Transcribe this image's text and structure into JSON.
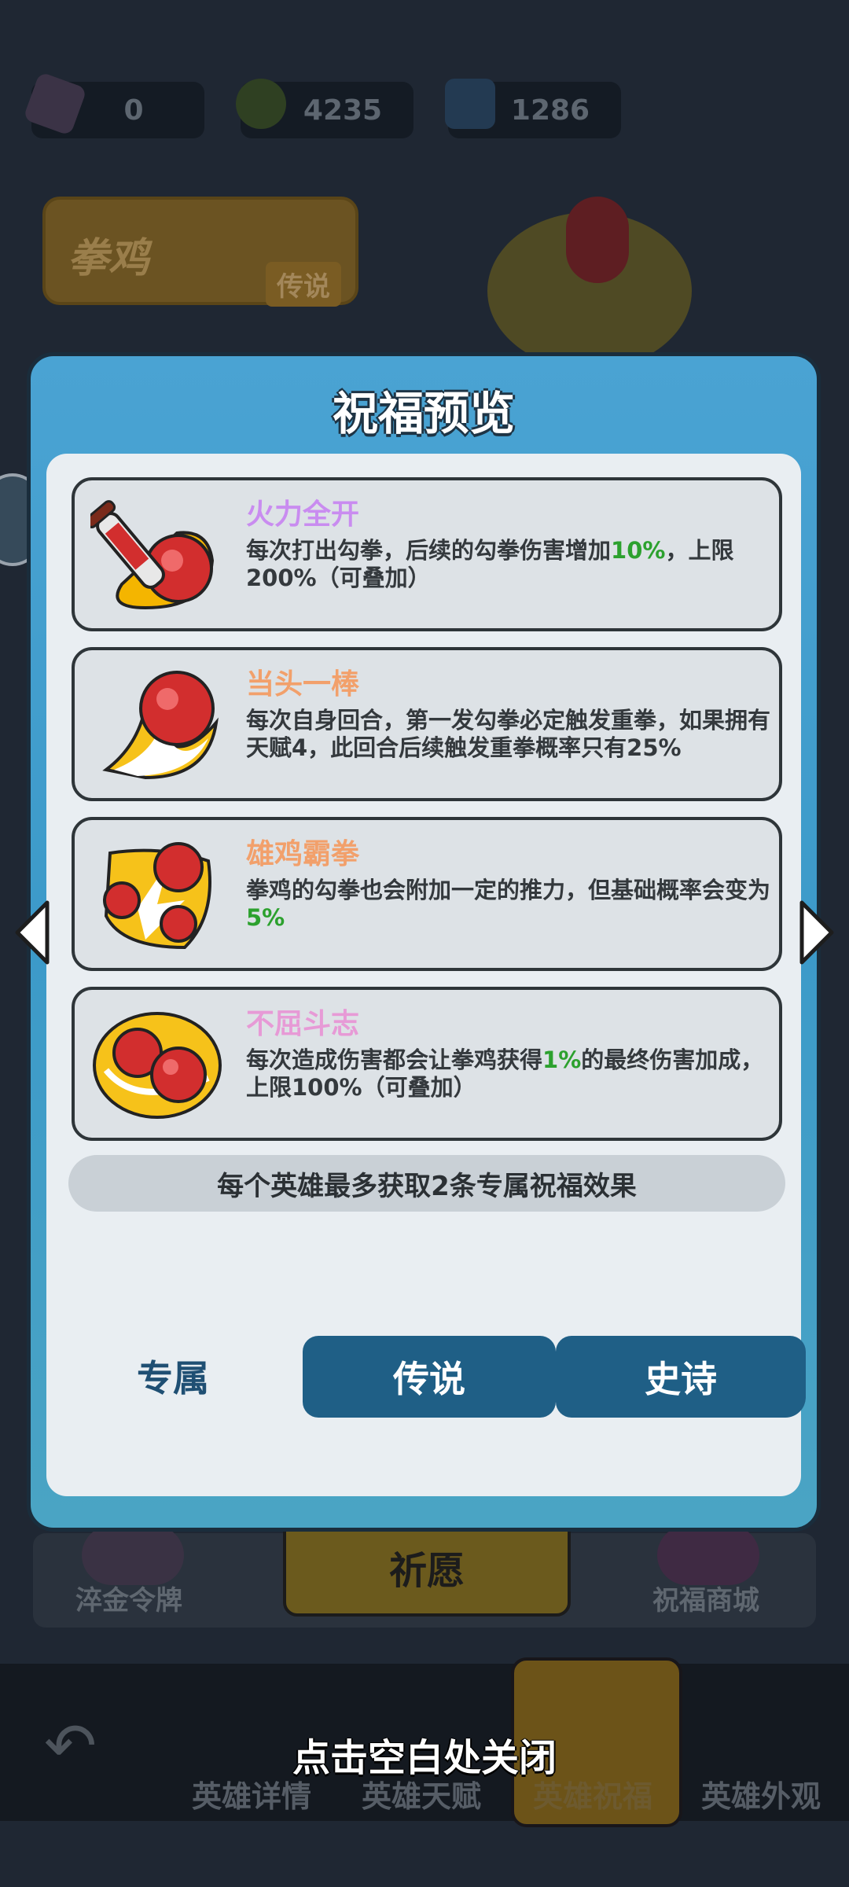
{
  "resources": [
    {
      "icon": "crystal-icon",
      "value": "0"
    },
    {
      "icon": "potion-icon",
      "value": "4235"
    },
    {
      "icon": "blue-gem-plus-icon",
      "value": "1286"
    }
  ],
  "hero": {
    "name": "拳鸡",
    "rarity": "传说"
  },
  "modal": {
    "title": "祝福预览",
    "blessings": [
      {
        "icon": "syringe-fist-icon",
        "title": "火力全开",
        "title_color": "#c98cf0",
        "desc_before": "每次打出勾拳，后续的勾拳伤害增加",
        "highlight": "10%",
        "desc_after": "，上限200%（可叠加）"
      },
      {
        "icon": "flaming-fist-icon",
        "title": "当头一棒",
        "title_color": "#f2a06b",
        "desc_before": "每次自身回合，第一发勾拳必定触发重拳，如果拥有天赋4，此回合后续触发重拳概率只有25%",
        "highlight": "",
        "desc_after": ""
      },
      {
        "icon": "triple-fist-icon",
        "title": "雄鸡霸拳",
        "title_color": "#f2a06b",
        "desc_before": "拳鸡的勾拳也会附加一定的推力，但基础概率会变为",
        "highlight": "5%",
        "desc_after": ""
      },
      {
        "icon": "double-fist-swirl-icon",
        "title": "不屈斗志",
        "title_color": "#e79ad6",
        "desc_before": "每次造成伤害都会让拳鸡获得",
        "highlight": "1%",
        "desc_after": "的最终伤害加成，上限100%（可叠加）"
      }
    ],
    "footnote": "每个英雄最多获取2条专属祝福效果",
    "tabs": [
      {
        "label": "专属",
        "active": true
      },
      {
        "label": "传说",
        "active": false
      },
      {
        "label": "史诗",
        "active": false
      }
    ]
  },
  "under_modal": {
    "pray_label": "祈愿",
    "left_label": "淬金令牌",
    "right_label": "祝福商城"
  },
  "bottom_nav": {
    "items": [
      {
        "label": "英雄详情"
      },
      {
        "label": "英雄天赋"
      },
      {
        "label": "英雄祝福",
        "active": true
      },
      {
        "label": "英雄外观"
      }
    ]
  },
  "close_hint": "点击空白处关闭"
}
